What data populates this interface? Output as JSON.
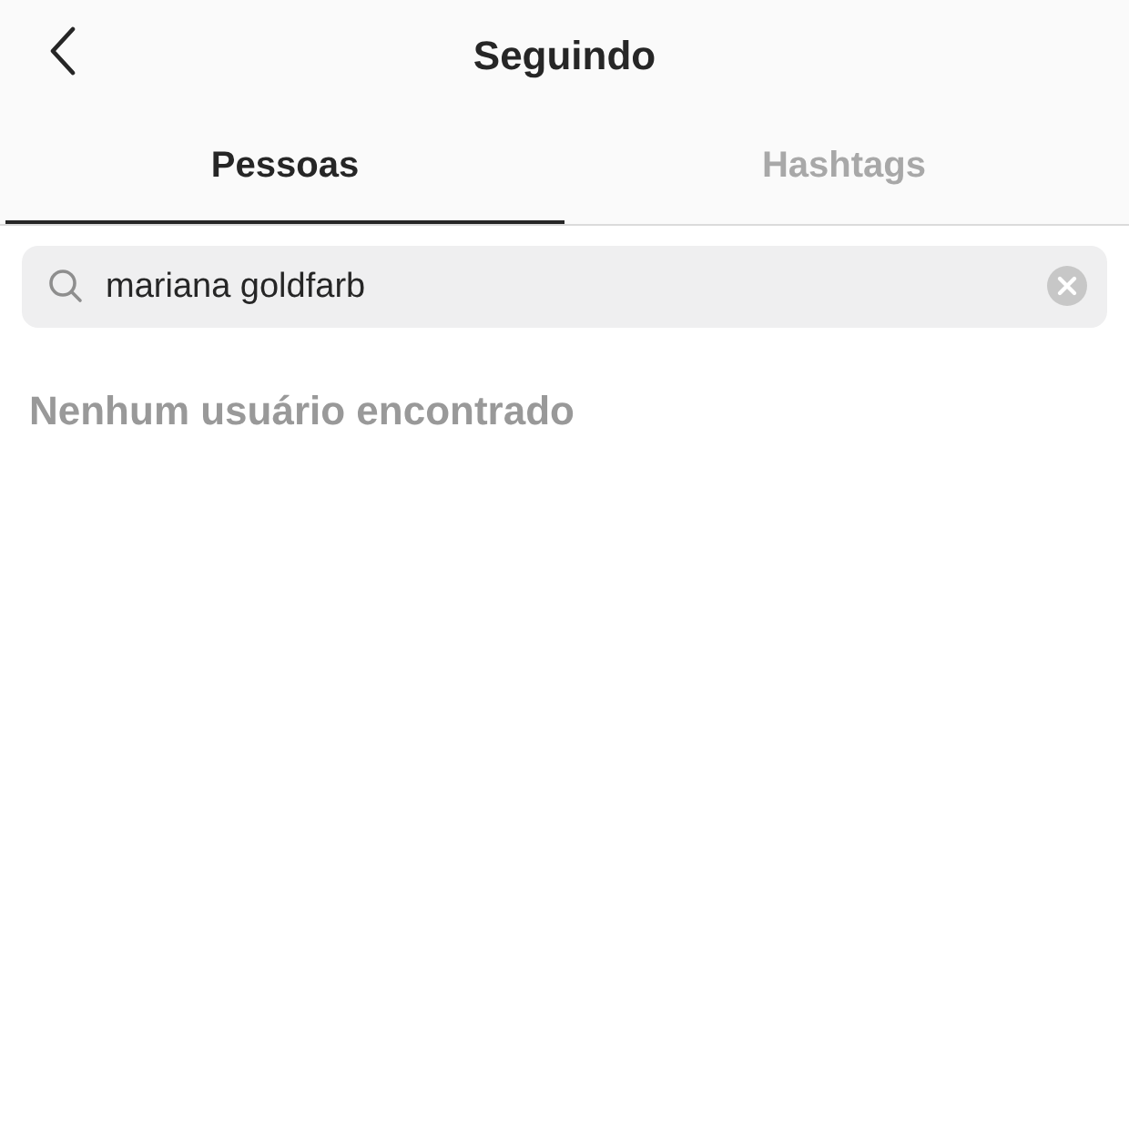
{
  "header": {
    "title": "Seguindo"
  },
  "tabs": [
    {
      "label": "Pessoas",
      "selected": true
    },
    {
      "label": "Hashtags",
      "selected": false
    }
  ],
  "search": {
    "value": "mariana goldfarb"
  },
  "empty_message": "Nenhum usuário encontrado"
}
